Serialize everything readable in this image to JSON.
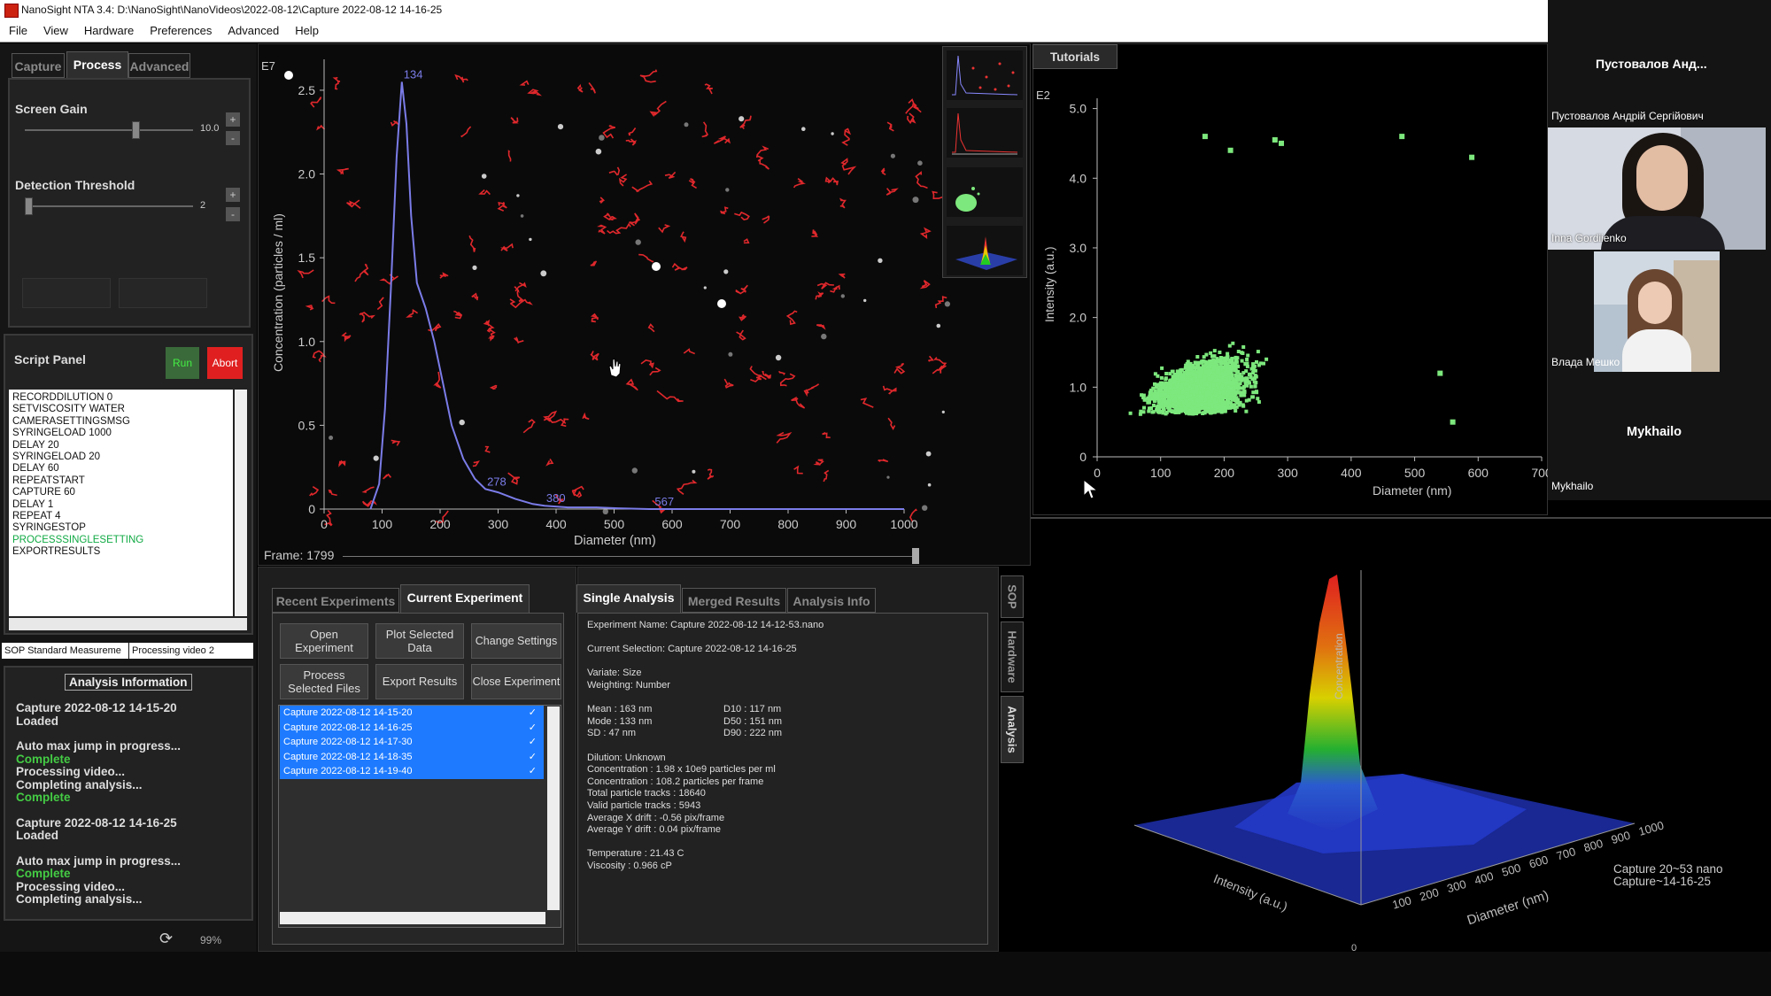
{
  "window": {
    "title": "NanoSight NTA 3.4: D:\\NanoSight\\NanoVideos\\2022-08-12\\Capture 2022-08-12 14-16-25"
  },
  "menu": [
    "File",
    "View",
    "Hardware",
    "Preferences",
    "Advanced",
    "Help"
  ],
  "left_tabs": [
    "Capture",
    "Process",
    "Advanced"
  ],
  "screen_gain": {
    "label": "Screen Gain",
    "value": "10.0",
    "level": 0.66
  },
  "detection_threshold": {
    "label": "Detection Threshold",
    "value": "2",
    "level": 0.02
  },
  "step_buttons": {
    "plus": "+",
    "minus": "-"
  },
  "script_panel": {
    "title": "Script Panel",
    "run": "Run",
    "abort": "Abort",
    "lines": [
      "RECORDDILUTION 0",
      "SETVISCOSITY WATER",
      "CAMERASETTINGSMSG",
      "SYRINGELOAD 1000",
      "DELAY 20",
      "SYRINGELOAD 20",
      "DELAY 60",
      "REPEATSTART",
      "CAPTURE 60",
      "DELAY 1",
      "REPEAT 4",
      "SYRINGESTOP",
      "PROCESSSINGLESETTING",
      "EXPORTRESULTS"
    ],
    "highlight_line": "PROCESSSINGLESETTING"
  },
  "status": {
    "left": "SOP Standard Measureme",
    "right": "Processing video 2"
  },
  "analysis_info": {
    "title": "Analysis Information",
    "lines": [
      {
        "text": "Capture 2022-08-12 14-15-20",
        "style": "normal"
      },
      {
        "text": "Loaded",
        "style": "normal"
      },
      {
        "text": "",
        "style": "gap"
      },
      {
        "text": "Auto max jump in progress...",
        "style": "bold"
      },
      {
        "text": "Complete",
        "style": "green"
      },
      {
        "text": "Processing video...",
        "style": "bold"
      },
      {
        "text": "Completing analysis...",
        "style": "bold"
      },
      {
        "text": "Complete",
        "style": "green"
      },
      {
        "text": "",
        "style": "gap"
      },
      {
        "text": "Capture 2022-08-12 14-16-25",
        "style": "normal"
      },
      {
        "text": "Loaded",
        "style": "normal"
      },
      {
        "text": "",
        "style": "gap"
      },
      {
        "text": "Auto max jump in progress...",
        "style": "bold"
      },
      {
        "text": "Complete",
        "style": "green"
      },
      {
        "text": "Processing video...",
        "style": "bold"
      },
      {
        "text": "Completing analysis...",
        "style": "bold"
      }
    ],
    "progress": "99%"
  },
  "center_plot": {
    "exponent": "E7",
    "ylabel": "Concentration (particles / ml)",
    "xlabel": "Diameter (nm)",
    "frame_label": "Frame:",
    "frame_value": "1799",
    "frame_position": 1.0
  },
  "chart_data": [
    {
      "type": "line",
      "title": "",
      "xlabel": "Diameter (nm)",
      "ylabel": "Concentration (particles / ml)",
      "y_exponent": "E7",
      "xlim": [
        0,
        1000
      ],
      "ylim": [
        0,
        2.6
      ],
      "x_ticks": [
        0,
        100,
        200,
        300,
        400,
        500,
        600,
        700,
        800,
        900,
        1000
      ],
      "y_ticks": [
        0,
        0.5,
        1.0,
        1.5,
        2.0,
        2.5
      ],
      "y_tick_labels": [
        "0",
        "0.5",
        "1.0",
        "1.5",
        "2.0",
        "2.5"
      ],
      "series": [
        {
          "x": [
            80,
            95,
            105,
            115,
            125,
            134,
            142,
            150,
            160,
            175,
            190,
            205,
            220,
            240,
            260,
            278,
            300,
            330,
            360,
            380,
            420,
            470,
            507,
            560,
            620,
            700,
            800,
            900,
            1000
          ],
          "y": [
            0,
            0.15,
            0.6,
            1.3,
            2.1,
            2.55,
            2.3,
            1.75,
            1.35,
            1.2,
            1.0,
            0.75,
            0.5,
            0.3,
            0.18,
            0.12,
            0.1,
            0.06,
            0.03,
            0.02,
            0.01,
            0.01,
            0.005,
            0,
            0,
            0,
            0,
            0,
            0
          ]
        }
      ],
      "annotations": [
        {
          "x": 134,
          "text": "134"
        },
        {
          "x": 278,
          "text": "278"
        },
        {
          "x": 380,
          "text": "380"
        },
        {
          "x": 567,
          "text": "567"
        }
      ]
    },
    {
      "type": "scatter",
      "title": "",
      "xlabel": "Diameter (nm)",
      "ylabel": "Intensity (a.u.)",
      "y_exponent": "E2",
      "xlim": [
        0,
        700
      ],
      "ylim": [
        0,
        5.3
      ],
      "x_ticks": [
        0,
        100,
        200,
        300,
        400,
        500,
        600,
        700
      ],
      "y_ticks": [
        0,
        1.0,
        2.0,
        3.0,
        4.0,
        5.0
      ],
      "y_tick_labels": [
        "0",
        "1.0",
        "2.0",
        "3.0",
        "4.0",
        "5.0"
      ],
      "x_tick_labels": [
        "0",
        "100",
        "200",
        "300",
        "400",
        "500",
        "600",
        "700"
      ],
      "color": "#7de87d",
      "outliers": [
        [
          210,
          4.4
        ],
        [
          280,
          4.55
        ],
        [
          290,
          4.5
        ],
        [
          590,
          4.3
        ],
        [
          480,
          4.6
        ],
        [
          170,
          4.6
        ],
        [
          540,
          1.2
        ],
        [
          560,
          0.5
        ]
      ]
    },
    {
      "type": "3d-surface",
      "title": "",
      "zlabel": "Concentration",
      "xlabel": "Intensity (a.u.)",
      "ylabel": "Diameter (nm)",
      "diameter_ticks": [
        "100",
        "200",
        "300",
        "400",
        "500",
        "600",
        "700",
        "800",
        "900",
        "1000"
      ]
    }
  ],
  "tutorials_tab": "Tutorials",
  "experiments": {
    "tabs": [
      "Recent Experiments",
      "Current Experiment"
    ],
    "buttons": [
      "Open Experiment",
      "Plot Selected Data",
      "Change Settings",
      "Process Selected Files",
      "Export Results",
      "Close Experiment"
    ],
    "files": [
      "Capture 2022-08-12 14-15-20",
      "Capture 2022-08-12 14-16-25",
      "Capture 2022-08-12 14-17-30",
      "Capture 2022-08-12 14-18-35",
      "Capture 2022-08-12 14-19-40"
    ],
    "check": "✓"
  },
  "single_analysis": {
    "tabs": [
      "Single Analysis",
      "Merged Results",
      "Analysis Info"
    ],
    "lines": [
      "Experiment Name: Capture 2022-08-12 14-12-53.nano",
      "",
      "Current Selection: Capture 2022-08-12 14-16-25",
      "",
      "Variate: Size",
      "Weighting: Number",
      "",
      "Mean : 163 nm",
      "Mode : 133 nm",
      "SD : 47 nm",
      "",
      "Dilution: Unknown",
      "Concentration : 1.98 x 10e9 particles per ml",
      "Concentration : 108.2 particles per frame",
      "Total particle tracks : 18640",
      "Valid particle tracks : 5943",
      "Average X drift : -0.56 pix/frame",
      "Average Y drift : 0.04 pix/frame",
      "",
      "Temperature : 21.43 C",
      "Viscosity : 0.966 cP"
    ],
    "d_values": [
      "D10 : 117 nm",
      "D50 : 151 nm",
      "D90 : 222 nm"
    ]
  },
  "side_tabs": [
    "SOP",
    "Hardware",
    "Analysis"
  ],
  "legend3d": [
    "Capture 20~53 nano",
    "Capture~14-16-25"
  ],
  "participants": {
    "header": "Пустовалов Анд...",
    "subheader": "Пустовалов Андрій Сергійович",
    "p1": "Inna Gordiienko",
    "p2": "Влада Мешко",
    "p3_big": "Mykhailo",
    "p3": "Mykhailo"
  }
}
